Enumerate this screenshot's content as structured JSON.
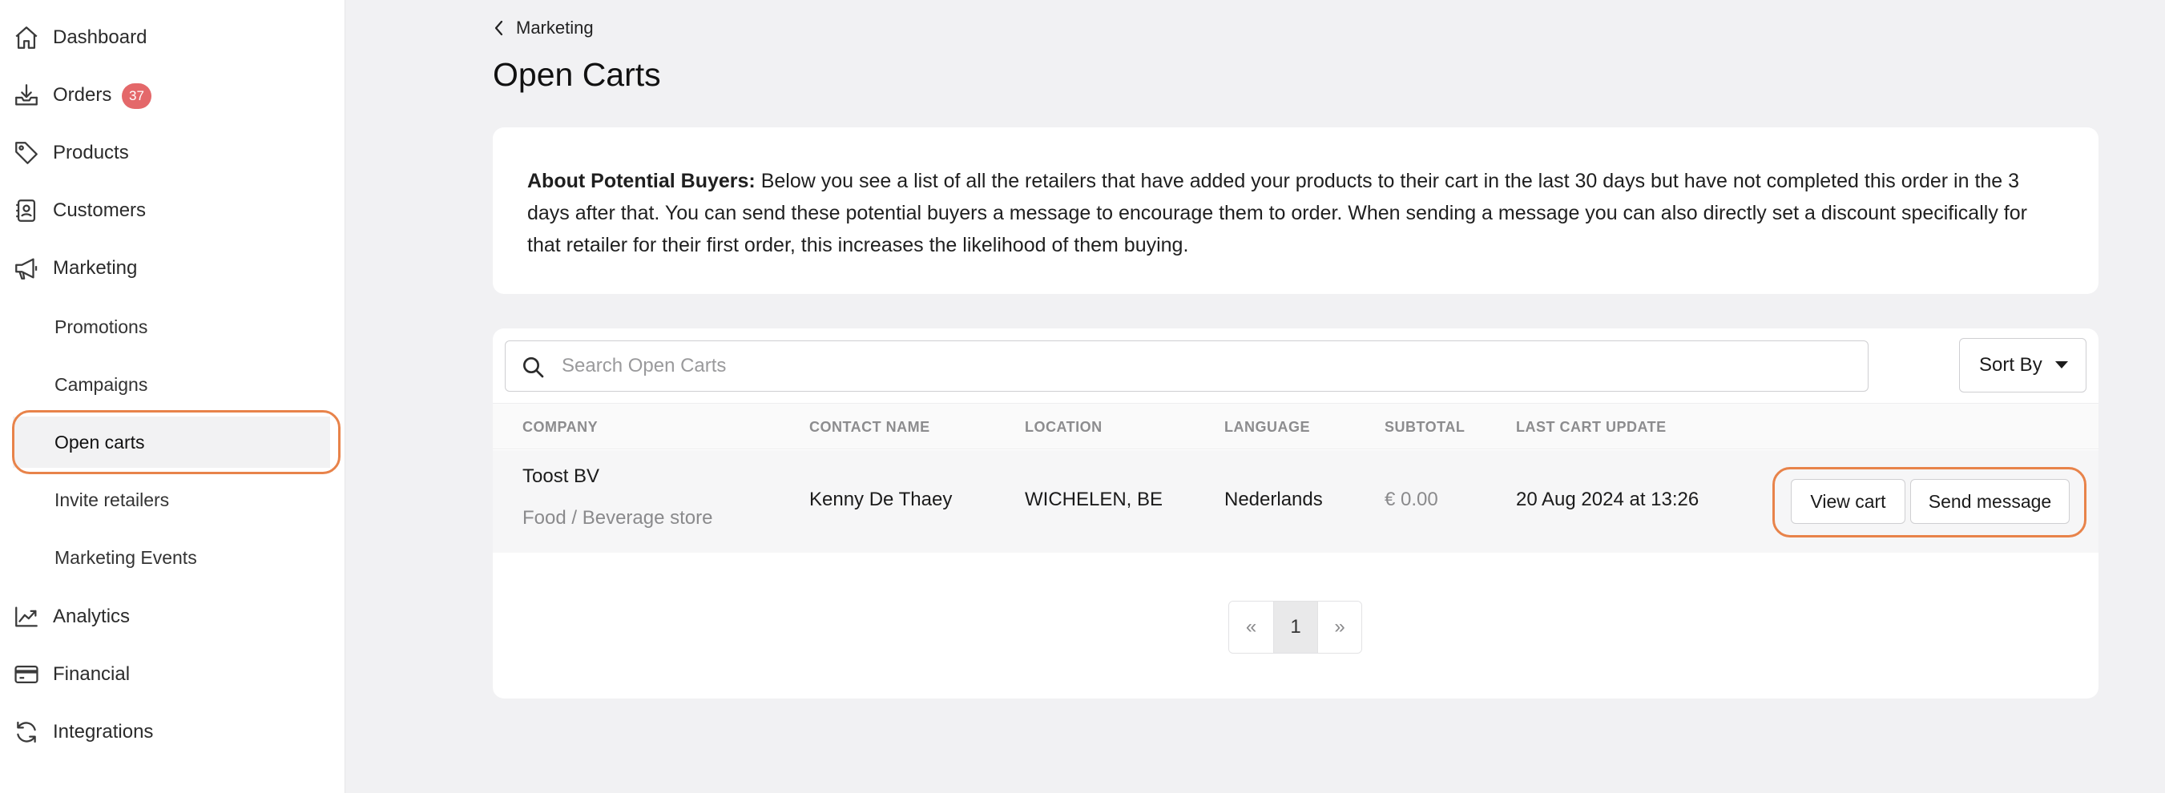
{
  "sidebar": {
    "items": [
      {
        "label": "Dashboard",
        "icon": "home-icon"
      },
      {
        "label": "Orders",
        "icon": "inbox-download-icon",
        "badge": "37"
      },
      {
        "label": "Products",
        "icon": "tag-icon"
      },
      {
        "label": "Customers",
        "icon": "contact-book-icon"
      },
      {
        "label": "Marketing",
        "icon": "megaphone-icon"
      }
    ],
    "marketing_subitems": [
      {
        "label": "Promotions"
      },
      {
        "label": "Campaigns"
      },
      {
        "label": "Open carts",
        "active": true
      },
      {
        "label": "Invite retailers"
      },
      {
        "label": "Marketing Events"
      }
    ],
    "bottom_items": [
      {
        "label": "Analytics",
        "icon": "chart-line-icon"
      },
      {
        "label": "Financial",
        "icon": "credit-card-icon"
      },
      {
        "label": "Integrations",
        "icon": "refresh-icon"
      }
    ]
  },
  "breadcrumb": {
    "label": "Marketing"
  },
  "page": {
    "title": "Open Carts"
  },
  "info": {
    "heading": "About Potential Buyers:",
    "body": " Below you see a list of all the retailers that have added your products to their cart in the last 30 days but have not completed this order in the 3 days after that. You can send these potential buyers a message to encourage them to order. When sending a message you can also directly set a discount specifically for that retailer for their first order, this increases the likelihood of them buying."
  },
  "search": {
    "placeholder": "Search Open Carts",
    "value": ""
  },
  "sort": {
    "label": "Sort By"
  },
  "table": {
    "columns": [
      "COMPANY",
      "CONTACT NAME",
      "LOCATION",
      "LANGUAGE",
      "SUBTOTAL",
      "LAST CART UPDATE"
    ],
    "rows": [
      {
        "company": "Toost BV",
        "company_type": "Food / Beverage store",
        "contact": "Kenny De Thaey",
        "location": "WICHELEN, BE",
        "language": "Nederlands",
        "subtotal": "€ 0.00",
        "last_update": "20 Aug 2024 at 13:26",
        "view_label": "View cart",
        "message_label": "Send message"
      }
    ]
  },
  "pagination": {
    "prev": "«",
    "current": "1",
    "next": "»"
  },
  "colors": {
    "accent_ring": "#e8834a",
    "badge": "#e4686a"
  }
}
